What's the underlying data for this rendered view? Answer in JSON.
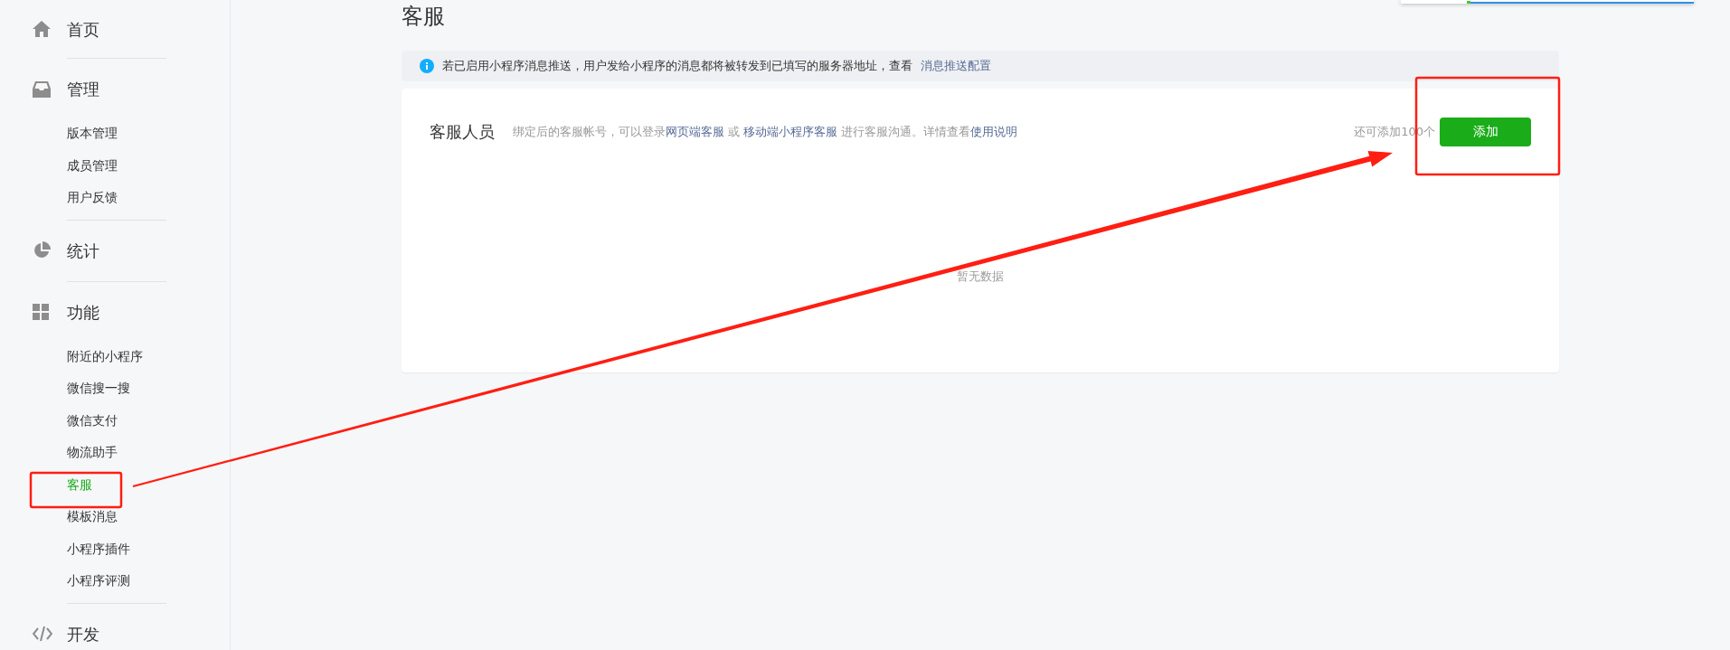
{
  "sidebar": {
    "sections": [
      {
        "label": "首页"
      },
      {
        "label": "管理",
        "items": [
          {
            "label": "版本管理",
            "selected": false
          },
          {
            "label": "成员管理",
            "selected": false
          },
          {
            "label": "用户反馈",
            "selected": false
          }
        ]
      },
      {
        "label": "统计"
      },
      {
        "label": "功能",
        "items": [
          {
            "label": "附近的小程序",
            "selected": false
          },
          {
            "label": "微信搜一搜",
            "selected": false
          },
          {
            "label": "微信支付",
            "selected": false
          },
          {
            "label": "物流助手",
            "selected": false
          },
          {
            "label": "客服",
            "selected": true
          },
          {
            "label": "模板消息",
            "selected": false
          },
          {
            "label": "小程序插件",
            "selected": false
          },
          {
            "label": "小程序评测",
            "selected": false
          }
        ]
      },
      {
        "label": "开发"
      }
    ]
  },
  "page": {
    "title": "客服",
    "notice": {
      "text": "若已启用小程序消息推送，用户发给小程序的消息都将被转发到已填写的服务器地址，查看",
      "link": "消息推送配置"
    },
    "card": {
      "title": "客服人员",
      "description": [
        {
          "kind": "text",
          "text": "绑定后的客服帐号，可以登录"
        },
        {
          "kind": "link",
          "text": "网页端客服"
        },
        {
          "kind": "text",
          "text": " 或 "
        },
        {
          "kind": "link",
          "text": "移动端小程序客服"
        },
        {
          "kind": "text",
          "text": " 进行客服沟通。详情查看"
        },
        {
          "kind": "link",
          "text": "使用说明"
        }
      ],
      "remaining": "还可添加100个",
      "add_button": "添加",
      "empty": "暂无数据"
    }
  }
}
